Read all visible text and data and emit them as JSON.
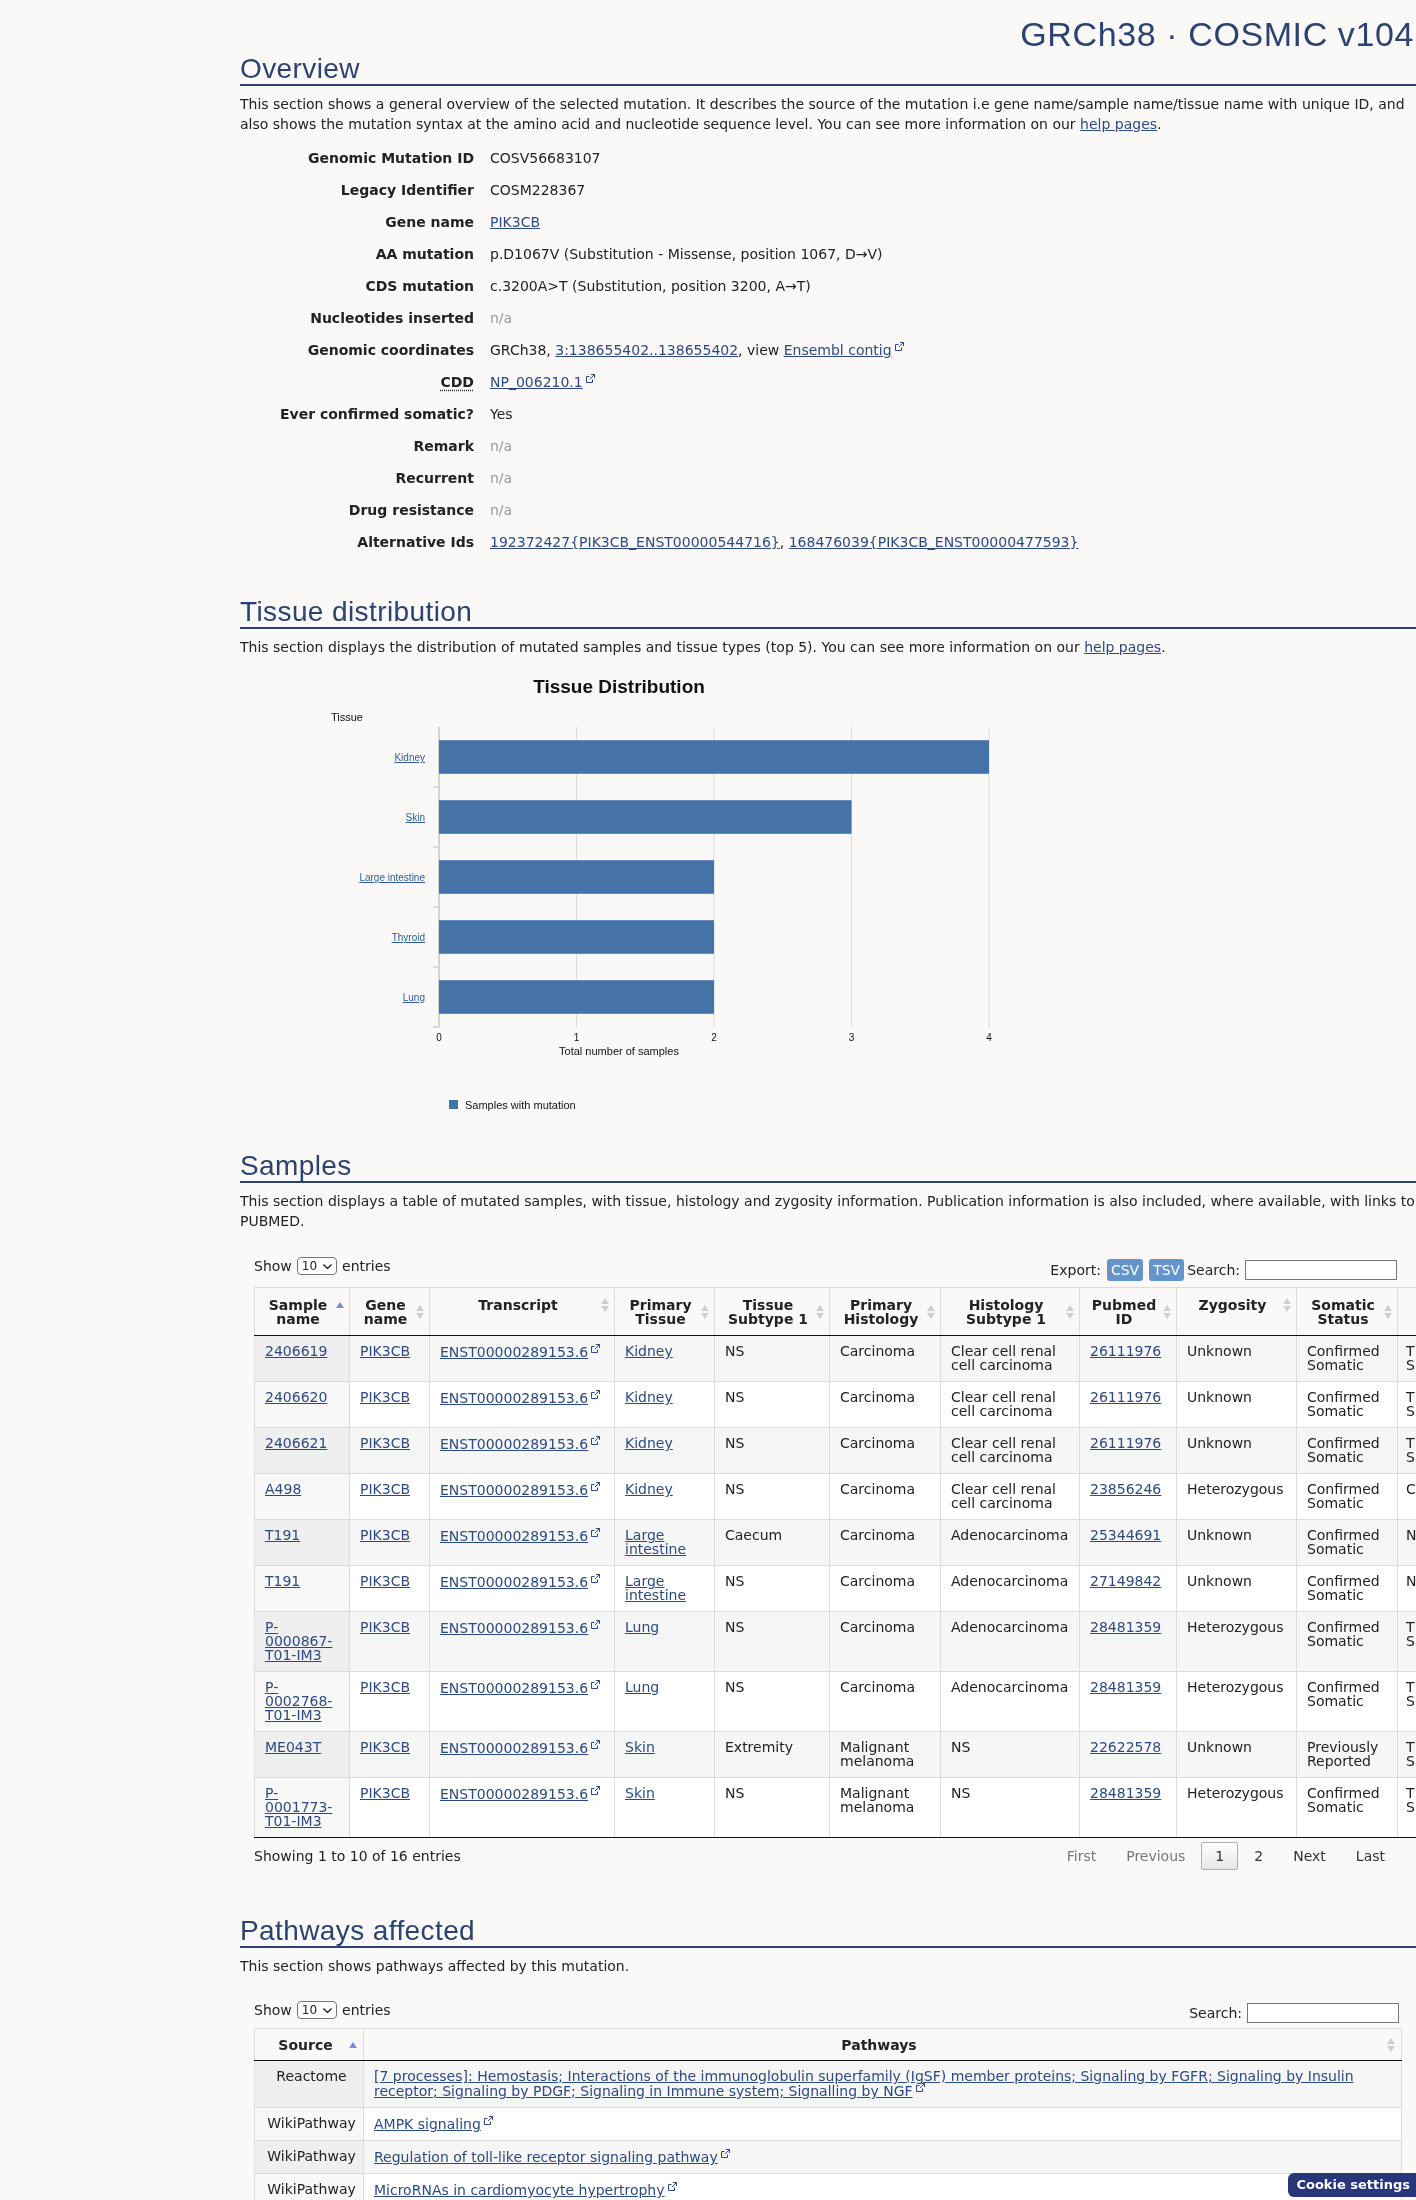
{
  "header": {
    "title": "GRCh38 · COSMIC v104"
  },
  "overview": {
    "heading": "Overview",
    "intro": {
      "text": "This section shows a general overview of the selected mutation. It describes the source of the mutation i.e gene name/sample name/tissue name with unique ID, and also shows the mutation syntax at the amino acid and nucleotide sequence level. You can see more information on our ",
      "link": "help pages",
      "after": "."
    },
    "fields": [
      {
        "label": "Genomic Mutation ID",
        "abbr": false,
        "value": [
          {
            "kind": "text",
            "text": "COSV56683107"
          }
        ]
      },
      {
        "label": "Legacy Identifier",
        "abbr": false,
        "value": [
          {
            "kind": "text",
            "text": "COSM228367"
          }
        ]
      },
      {
        "label": "Gene name",
        "abbr": false,
        "value": [
          {
            "kind": "link",
            "text": "PIK3CB"
          }
        ]
      },
      {
        "label": "AA mutation",
        "abbr": false,
        "value": [
          {
            "kind": "text",
            "text": "p.D1067V (Substitution - Missense, position 1067, D→V)"
          }
        ]
      },
      {
        "label": "CDS mutation",
        "abbr": false,
        "value": [
          {
            "kind": "text",
            "text": "c.3200A>T (Substitution, position 3200, A→T)"
          }
        ]
      },
      {
        "label": "Nucleotides inserted",
        "abbr": false,
        "value": [
          {
            "kind": "muted",
            "text": "n/a"
          }
        ]
      },
      {
        "label": "Genomic coordinates",
        "abbr": false,
        "value": [
          {
            "kind": "text",
            "text": "GRCh38, "
          },
          {
            "kind": "link",
            "text": "3:138655402..138655402"
          },
          {
            "kind": "text",
            "text": ", view "
          },
          {
            "kind": "ext-link",
            "text": "Ensembl contig"
          }
        ]
      },
      {
        "label": "CDD",
        "abbr": true,
        "value": [
          {
            "kind": "ext-link",
            "text": "NP_006210.1"
          }
        ]
      },
      {
        "label": "Ever confirmed somatic?",
        "abbr": false,
        "value": [
          {
            "kind": "text",
            "text": "Yes"
          }
        ]
      },
      {
        "label": "Remark",
        "abbr": false,
        "value": [
          {
            "kind": "muted",
            "text": "n/a"
          }
        ]
      },
      {
        "label": "Recurrent",
        "abbr": false,
        "value": [
          {
            "kind": "muted",
            "text": "n/a"
          }
        ]
      },
      {
        "label": "Drug resistance",
        "abbr": false,
        "value": [
          {
            "kind": "muted",
            "text": "n/a"
          }
        ]
      },
      {
        "label": "Alternative Ids",
        "abbr": false,
        "value": [
          {
            "kind": "link",
            "text": "192372427{PIK3CB_ENST00000544716}"
          },
          {
            "kind": "text",
            "text": ", "
          },
          {
            "kind": "link",
            "text": "168476039{PIK3CB_ENST00000477593}"
          }
        ]
      }
    ]
  },
  "tissue": {
    "heading": "Tissue distribution",
    "intro": {
      "text": "This section displays the distribution of mutated samples and tissue types (top 5). You can see more information on our ",
      "link": "help pages",
      "after": "."
    },
    "chart_data": {
      "type": "bar",
      "orientation": "horizontal",
      "title": "Tissue Distribution",
      "xlabel": "Total number of samples",
      "ylabel": "Tissue",
      "categories": [
        "Kidney",
        "Skin",
        "Large intestine",
        "Thyroid",
        "Lung"
      ],
      "series": [
        {
          "name": "Samples with mutation",
          "color": "#4572a7",
          "values": [
            4,
            3,
            2,
            2,
            2
          ]
        }
      ],
      "xlim": [
        0,
        4
      ],
      "xticks": [
        0,
        1,
        2,
        3,
        4
      ],
      "grid": true
    }
  },
  "samples": {
    "heading": "Samples",
    "intro": "This section displays a table of mutated samples, with tissue, histology and zygosity information. Publication information is also included, where available, with links to PUBMED.",
    "length": {
      "before": "Show",
      "value": "10",
      "after": "entries"
    },
    "export": {
      "label": "Export:",
      "buttons": [
        "CSV",
        "TSV"
      ]
    },
    "search": {
      "label": "Search:"
    },
    "columns": [
      {
        "label": "Sample name",
        "sorted": true
      },
      {
        "label": "Gene name",
        "sorted": false
      },
      {
        "label": "Transcript",
        "sorted": false
      },
      {
        "label": "Primary Tissue",
        "sorted": false
      },
      {
        "label": "Tissue Subtype 1",
        "sorted": false
      },
      {
        "label": "Primary Histology",
        "sorted": false
      },
      {
        "label": "Histology Subtype 1",
        "sorted": false
      },
      {
        "label": "Pubmed ID",
        "sorted": false
      },
      {
        "label": "Zygosity",
        "sorted": false
      },
      {
        "label": "Somatic Status",
        "sorted": false
      }
    ],
    "rows": [
      {
        "cells": [
          {
            "kind": "link",
            "text": "2406619"
          },
          {
            "kind": "link",
            "text": "PIK3CB"
          },
          {
            "kind": "ext-link",
            "text": "ENST00000289153.6"
          },
          {
            "kind": "link",
            "text": "Kidney"
          },
          {
            "kind": "text",
            "text": "NS"
          },
          {
            "kind": "text",
            "text": "Carcinoma"
          },
          {
            "kind": "text",
            "text": "Clear cell renal cell carcinoma"
          },
          {
            "kind": "link",
            "text": "26111976"
          },
          {
            "kind": "text",
            "text": "Unknown"
          },
          {
            "kind": "text",
            "text": "Confirmed Somatic"
          },
          {
            "kind": "text",
            "text": "T S"
          }
        ]
      },
      {
        "cells": [
          {
            "kind": "link",
            "text": "2406620"
          },
          {
            "kind": "link",
            "text": "PIK3CB"
          },
          {
            "kind": "ext-link",
            "text": "ENST00000289153.6"
          },
          {
            "kind": "link",
            "text": "Kidney"
          },
          {
            "kind": "text",
            "text": "NS"
          },
          {
            "kind": "text",
            "text": "Carcinoma"
          },
          {
            "kind": "text",
            "text": "Clear cell renal cell carcinoma"
          },
          {
            "kind": "link",
            "text": "26111976"
          },
          {
            "kind": "text",
            "text": "Unknown"
          },
          {
            "kind": "text",
            "text": "Confirmed Somatic"
          },
          {
            "kind": "text",
            "text": "T S"
          }
        ]
      },
      {
        "cells": [
          {
            "kind": "link",
            "text": "2406621"
          },
          {
            "kind": "link",
            "text": "PIK3CB"
          },
          {
            "kind": "ext-link",
            "text": "ENST00000289153.6"
          },
          {
            "kind": "link",
            "text": "Kidney"
          },
          {
            "kind": "text",
            "text": "NS"
          },
          {
            "kind": "text",
            "text": "Carcinoma"
          },
          {
            "kind": "text",
            "text": "Clear cell renal cell carcinoma"
          },
          {
            "kind": "link",
            "text": "26111976"
          },
          {
            "kind": "text",
            "text": "Unknown"
          },
          {
            "kind": "text",
            "text": "Confirmed Somatic"
          },
          {
            "kind": "text",
            "text": "T S"
          }
        ]
      },
      {
        "cells": [
          {
            "kind": "link",
            "text": "A498"
          },
          {
            "kind": "link",
            "text": "PIK3CB"
          },
          {
            "kind": "ext-link",
            "text": "ENST00000289153.6"
          },
          {
            "kind": "link",
            "text": "Kidney"
          },
          {
            "kind": "text",
            "text": "NS"
          },
          {
            "kind": "text",
            "text": "Carcinoma"
          },
          {
            "kind": "text",
            "text": "Clear cell renal cell carcinoma"
          },
          {
            "kind": "link",
            "text": "23856246"
          },
          {
            "kind": "text",
            "text": "Heterozygous"
          },
          {
            "kind": "text",
            "text": "Confirmed Somatic"
          },
          {
            "kind": "text",
            "text": "C"
          }
        ]
      },
      {
        "cells": [
          {
            "kind": "link",
            "text": "T191"
          },
          {
            "kind": "link",
            "text": "PIK3CB"
          },
          {
            "kind": "ext-link",
            "text": "ENST00000289153.6"
          },
          {
            "kind": "link",
            "text": "Large intestine"
          },
          {
            "kind": "text",
            "text": "Caecum"
          },
          {
            "kind": "text",
            "text": "Carcinoma"
          },
          {
            "kind": "text",
            "text": "Adenocarcinoma"
          },
          {
            "kind": "link",
            "text": "25344691"
          },
          {
            "kind": "text",
            "text": "Unknown"
          },
          {
            "kind": "text",
            "text": "Confirmed Somatic"
          },
          {
            "kind": "text",
            "text": "N"
          }
        ]
      },
      {
        "cells": [
          {
            "kind": "link",
            "text": "T191"
          },
          {
            "kind": "link",
            "text": "PIK3CB"
          },
          {
            "kind": "ext-link",
            "text": "ENST00000289153.6"
          },
          {
            "kind": "link",
            "text": "Large intestine"
          },
          {
            "kind": "text",
            "text": "NS"
          },
          {
            "kind": "text",
            "text": "Carcinoma"
          },
          {
            "kind": "text",
            "text": "Adenocarcinoma"
          },
          {
            "kind": "link",
            "text": "27149842"
          },
          {
            "kind": "text",
            "text": "Unknown"
          },
          {
            "kind": "text",
            "text": "Confirmed Somatic"
          },
          {
            "kind": "text",
            "text": "N"
          }
        ]
      },
      {
        "cells": [
          {
            "kind": "link",
            "text": "P-0000867-T01-IM3"
          },
          {
            "kind": "link",
            "text": "PIK3CB"
          },
          {
            "kind": "ext-link",
            "text": "ENST00000289153.6"
          },
          {
            "kind": "link",
            "text": "Lung"
          },
          {
            "kind": "text",
            "text": "NS"
          },
          {
            "kind": "text",
            "text": "Carcinoma"
          },
          {
            "kind": "text",
            "text": "Adenocarcinoma"
          },
          {
            "kind": "link",
            "text": "28481359"
          },
          {
            "kind": "text",
            "text": "Heterozygous"
          },
          {
            "kind": "text",
            "text": "Confirmed Somatic"
          },
          {
            "kind": "text",
            "text": "T S"
          }
        ]
      },
      {
        "cells": [
          {
            "kind": "link",
            "text": "P-0002768-T01-IM3"
          },
          {
            "kind": "link",
            "text": "PIK3CB"
          },
          {
            "kind": "ext-link",
            "text": "ENST00000289153.6"
          },
          {
            "kind": "link",
            "text": "Lung"
          },
          {
            "kind": "text",
            "text": "NS"
          },
          {
            "kind": "text",
            "text": "Carcinoma"
          },
          {
            "kind": "text",
            "text": "Adenocarcinoma"
          },
          {
            "kind": "link",
            "text": "28481359"
          },
          {
            "kind": "text",
            "text": "Heterozygous"
          },
          {
            "kind": "text",
            "text": "Confirmed Somatic"
          },
          {
            "kind": "text",
            "text": "T S"
          }
        ]
      },
      {
        "cells": [
          {
            "kind": "link",
            "text": "ME043T"
          },
          {
            "kind": "link",
            "text": "PIK3CB"
          },
          {
            "kind": "ext-link",
            "text": "ENST00000289153.6"
          },
          {
            "kind": "link",
            "text": "Skin"
          },
          {
            "kind": "text",
            "text": "Extremity"
          },
          {
            "kind": "text",
            "text": "Malignant melanoma"
          },
          {
            "kind": "text",
            "text": "NS"
          },
          {
            "kind": "link",
            "text": "22622578"
          },
          {
            "kind": "text",
            "text": "Unknown"
          },
          {
            "kind": "text",
            "text": "Previously Reported"
          },
          {
            "kind": "text",
            "text": "T S"
          }
        ]
      },
      {
        "cells": [
          {
            "kind": "link",
            "text": "P-0001773-T01-IM3"
          },
          {
            "kind": "link",
            "text": "PIK3CB"
          },
          {
            "kind": "ext-link",
            "text": "ENST00000289153.6"
          },
          {
            "kind": "link",
            "text": "Skin"
          },
          {
            "kind": "text",
            "text": "NS"
          },
          {
            "kind": "text",
            "text": "Malignant melanoma"
          },
          {
            "kind": "text",
            "text": "NS"
          },
          {
            "kind": "link",
            "text": "28481359"
          },
          {
            "kind": "text",
            "text": "Heterozygous"
          },
          {
            "kind": "text",
            "text": "Confirmed Somatic"
          },
          {
            "kind": "text",
            "text": "T S"
          }
        ]
      }
    ],
    "info": "Showing 1 to 10 of 16 entries",
    "pages": [
      {
        "label": "First",
        "selected": false,
        "disabled": true
      },
      {
        "label": "Previous",
        "selected": false,
        "disabled": true
      },
      {
        "label": "1",
        "selected": true,
        "disabled": false
      },
      {
        "label": "2",
        "selected": false,
        "disabled": false
      },
      {
        "label": "Next",
        "selected": false,
        "disabled": false
      },
      {
        "label": "Last",
        "selected": false,
        "disabled": false
      }
    ]
  },
  "pathways": {
    "heading": "Pathways affected",
    "intro": "This section shows pathways affected by this mutation.",
    "length": {
      "before": "Show",
      "value": "10",
      "after": "entries"
    },
    "search": {
      "label": "Search:"
    },
    "columns": [
      {
        "label": "Source",
        "sorted": true
      },
      {
        "label": "Pathways",
        "sorted": false
      }
    ],
    "rows": [
      {
        "cells": [
          {
            "kind": "text",
            "text": "Reactome"
          },
          {
            "kind": "ext-link",
            "text": "[7 processes]: Hemostasis; Interactions of the immunoglobulin superfamily (IgSF) member proteins; Signaling by FGFR; Signaling by Insulin receptor; Signaling by PDGF; Signaling in Immune system; Signalling by NGF"
          }
        ]
      },
      {
        "cells": [
          {
            "kind": "text",
            "text": "WikiPathway"
          },
          {
            "kind": "ext-link",
            "text": "AMPK signaling"
          }
        ]
      },
      {
        "cells": [
          {
            "kind": "text",
            "text": "WikiPathway"
          },
          {
            "kind": "ext-link",
            "text": "Regulation of toll-like receptor signaling pathway"
          }
        ]
      },
      {
        "cells": [
          {
            "kind": "text",
            "text": "WikiPathway"
          },
          {
            "kind": "ext-link",
            "text": "MicroRNAs in cardiomyocyte hypertrophy"
          }
        ]
      }
    ]
  },
  "cookie_button": {
    "label": "Cookie settings"
  }
}
